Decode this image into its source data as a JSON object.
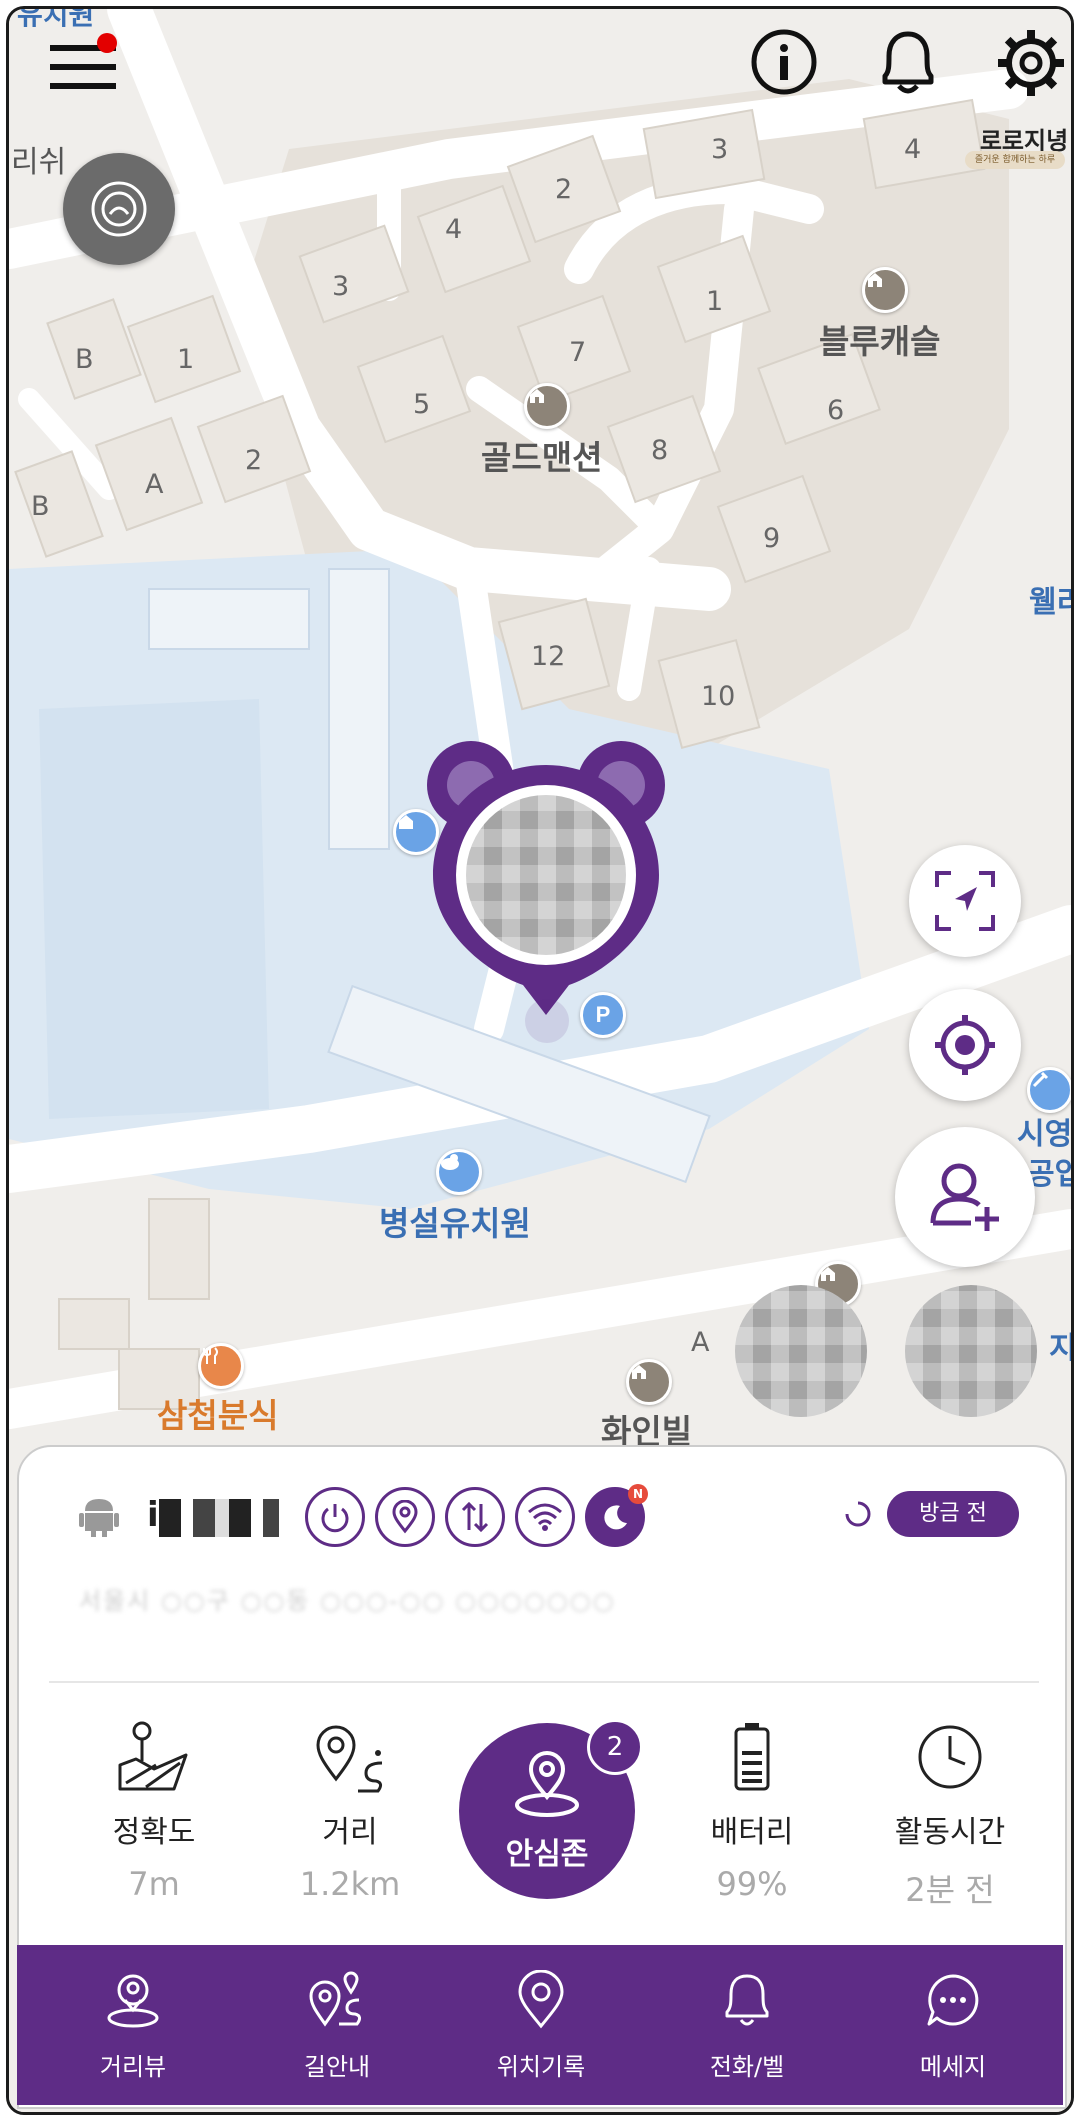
{
  "map": {
    "buildings": [
      "3",
      "4",
      "2",
      "4",
      "1",
      "3",
      "7",
      "5",
      "B",
      "1",
      "8",
      "6",
      "A",
      "2",
      "B",
      "9",
      "12",
      "10"
    ],
    "pois": {
      "blue_castle": "블루캐슬",
      "gold_mansion": "골드맨션",
      "kindergarten": "병설유치원",
      "snack": "삼첩분식",
      "villa": "화인빌",
      "wellness_partial": "웰리",
      "auto_partial": "시영자동",
      "auto_partial2": "공업사",
      "left_partial": "리쉬",
      "top_partial": "유치원",
      "right_partial": "지",
      "a_partial": "A"
    }
  },
  "header": {
    "brand": "로로지녕",
    "brand_tagline": "즐거운 함께하는 하루"
  },
  "device": {
    "name": "i",
    "status_icons": [
      "power-icon",
      "location-icon",
      "data-icon",
      "wifi-icon",
      "night-mode-icon"
    ],
    "night_badge": "N",
    "time": "방금 전",
    "address": "서울시 ○○구 ○○동 ○○○-○○ ○○○○○○○"
  },
  "stats": {
    "accuracy": {
      "label": "정확도",
      "value": "7m"
    },
    "distance": {
      "label": "거리",
      "value": "1.2km"
    },
    "safezone": {
      "label": "안심존",
      "badge": "2"
    },
    "battery": {
      "label": "배터리",
      "value": "99%"
    },
    "activity": {
      "label": "활동시간",
      "value": "2분 전"
    }
  },
  "nav": {
    "distance_view": "거리뷰",
    "directions": "길안내",
    "location_history": "위치기록",
    "call_bell": "전화/벨",
    "message": "메세지"
  },
  "colors": {
    "accent": "#5e2c86"
  }
}
